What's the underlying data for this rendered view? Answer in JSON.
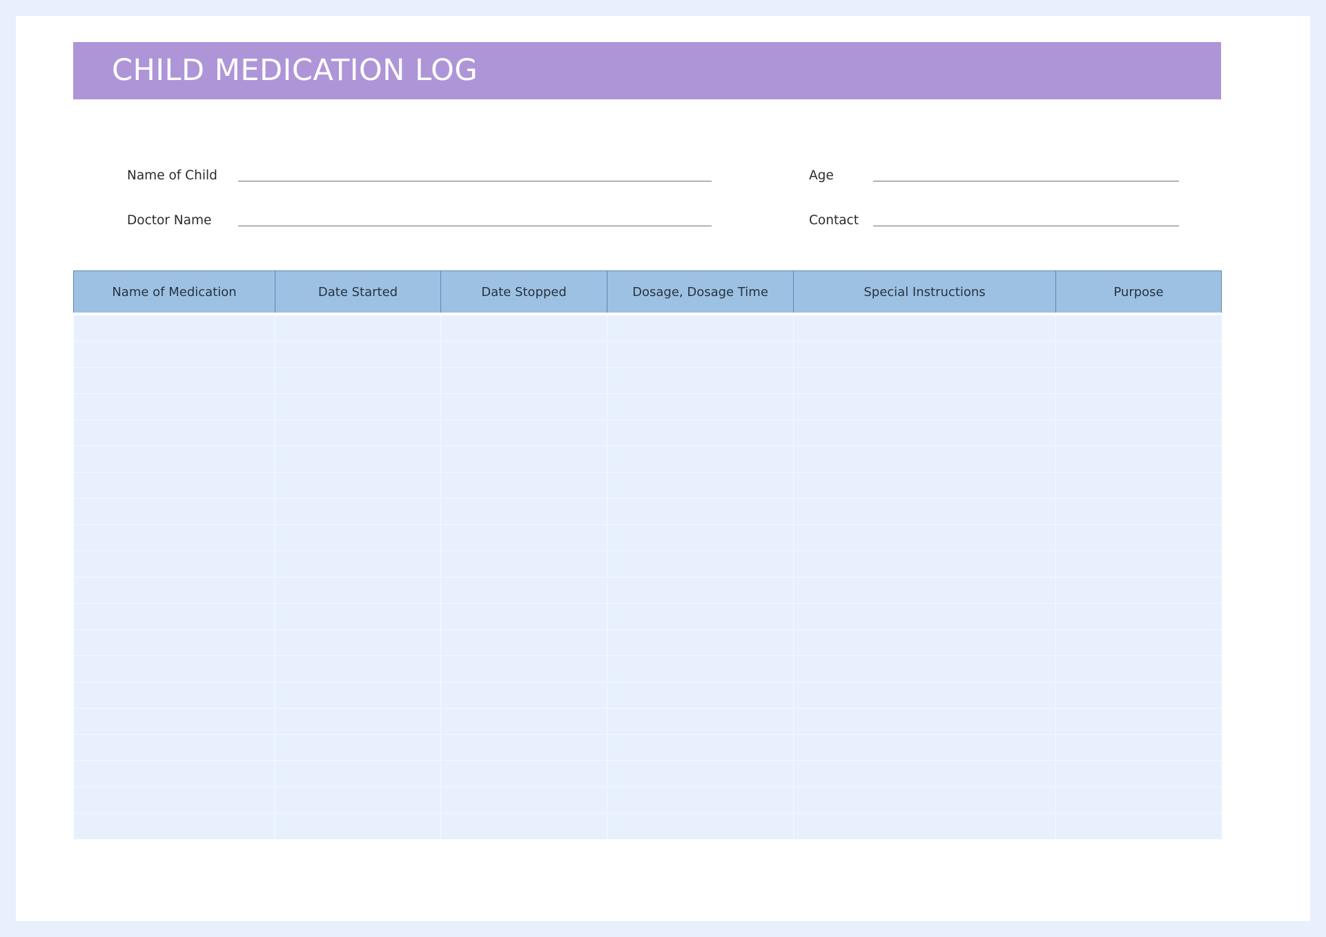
{
  "title": "CHILD MEDICATION LOG",
  "colors": {
    "page_background": "#e8f0fd",
    "sheet": "#ffffff",
    "title_bar": "#ae95d7",
    "table_header": "#9dc1e3",
    "table_body": "#e8f0fd"
  },
  "fields": {
    "child_name_label": "Name of Child",
    "age_label": "Age",
    "doctor_name_label": "Doctor Name",
    "contact_label": "Contact",
    "child_name_value": "",
    "age_value": "",
    "doctor_name_value": "",
    "contact_value": ""
  },
  "table": {
    "columns": [
      "Name of Medication",
      "Date Started",
      "Date Stopped",
      "Dosage, Dosage Time",
      "Special Instructions",
      "Purpose"
    ],
    "rows": [
      [
        "",
        "",
        "",
        "",
        "",
        ""
      ],
      [
        "",
        "",
        "",
        "",
        "",
        ""
      ],
      [
        "",
        "",
        "",
        "",
        "",
        ""
      ],
      [
        "",
        "",
        "",
        "",
        "",
        ""
      ],
      [
        "",
        "",
        "",
        "",
        "",
        ""
      ],
      [
        "",
        "",
        "",
        "",
        "",
        ""
      ],
      [
        "",
        "",
        "",
        "",
        "",
        ""
      ],
      [
        "",
        "",
        "",
        "",
        "",
        ""
      ],
      [
        "",
        "",
        "",
        "",
        "",
        ""
      ],
      [
        "",
        "",
        "",
        "",
        "",
        ""
      ],
      [
        "",
        "",
        "",
        "",
        "",
        ""
      ],
      [
        "",
        "",
        "",
        "",
        "",
        ""
      ],
      [
        "",
        "",
        "",
        "",
        "",
        ""
      ],
      [
        "",
        "",
        "",
        "",
        "",
        ""
      ],
      [
        "",
        "",
        "",
        "",
        "",
        ""
      ],
      [
        "",
        "",
        "",
        "",
        "",
        ""
      ],
      [
        "",
        "",
        "",
        "",
        "",
        ""
      ],
      [
        "",
        "",
        "",
        "",
        "",
        ""
      ],
      [
        "",
        "",
        "",
        "",
        "",
        ""
      ],
      [
        "",
        "",
        "",
        "",
        "",
        ""
      ]
    ]
  }
}
